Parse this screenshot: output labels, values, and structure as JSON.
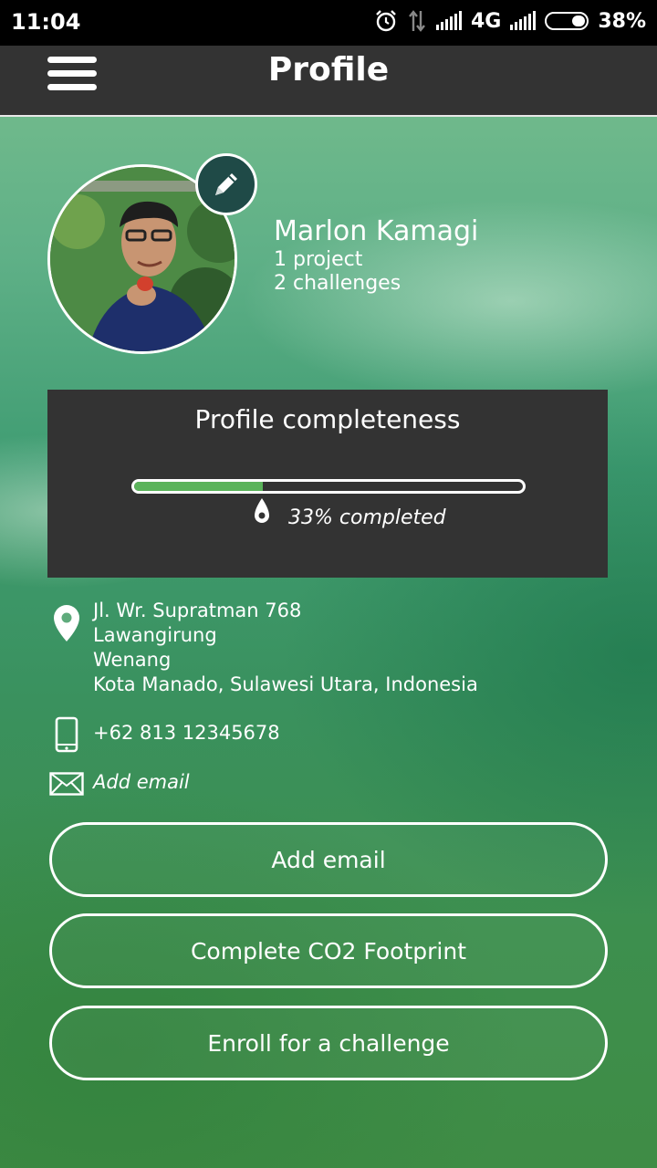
{
  "status_bar": {
    "time": "11:04",
    "network": "4G",
    "battery": "38%",
    "icons": [
      "alarm-icon",
      "data-arrows-icon",
      "signal-icon",
      "signal-icon",
      "battery-icon"
    ]
  },
  "header": {
    "title": "Profile",
    "menu_icon": "hamburger-menu-icon"
  },
  "profile": {
    "name": "Marlon Kamagi",
    "projects": "1 project",
    "challenges": "2 challenges",
    "edit_icon": "pencil-icon"
  },
  "completeness": {
    "title": "Profile completeness",
    "progress": 0.33,
    "label": "33% completed",
    "fill_color": "#5bb35b"
  },
  "contact": {
    "address_lines": [
      "Jl. Wr. Supratman 768",
      "Lawangirung",
      "Wenang",
      "Kota Manado, Sulawesi Utara, Indonesia"
    ],
    "phone": "+62 813 12345678",
    "email_placeholder": "Add email"
  },
  "actions": {
    "add_email": "Add email",
    "complete_co2": "Complete CO2 Footprint",
    "enroll_challenge": "Enroll for a challenge"
  },
  "colors": {
    "appbar": "#333333",
    "panel": "#333333",
    "edit_button": "#1f4a47"
  }
}
